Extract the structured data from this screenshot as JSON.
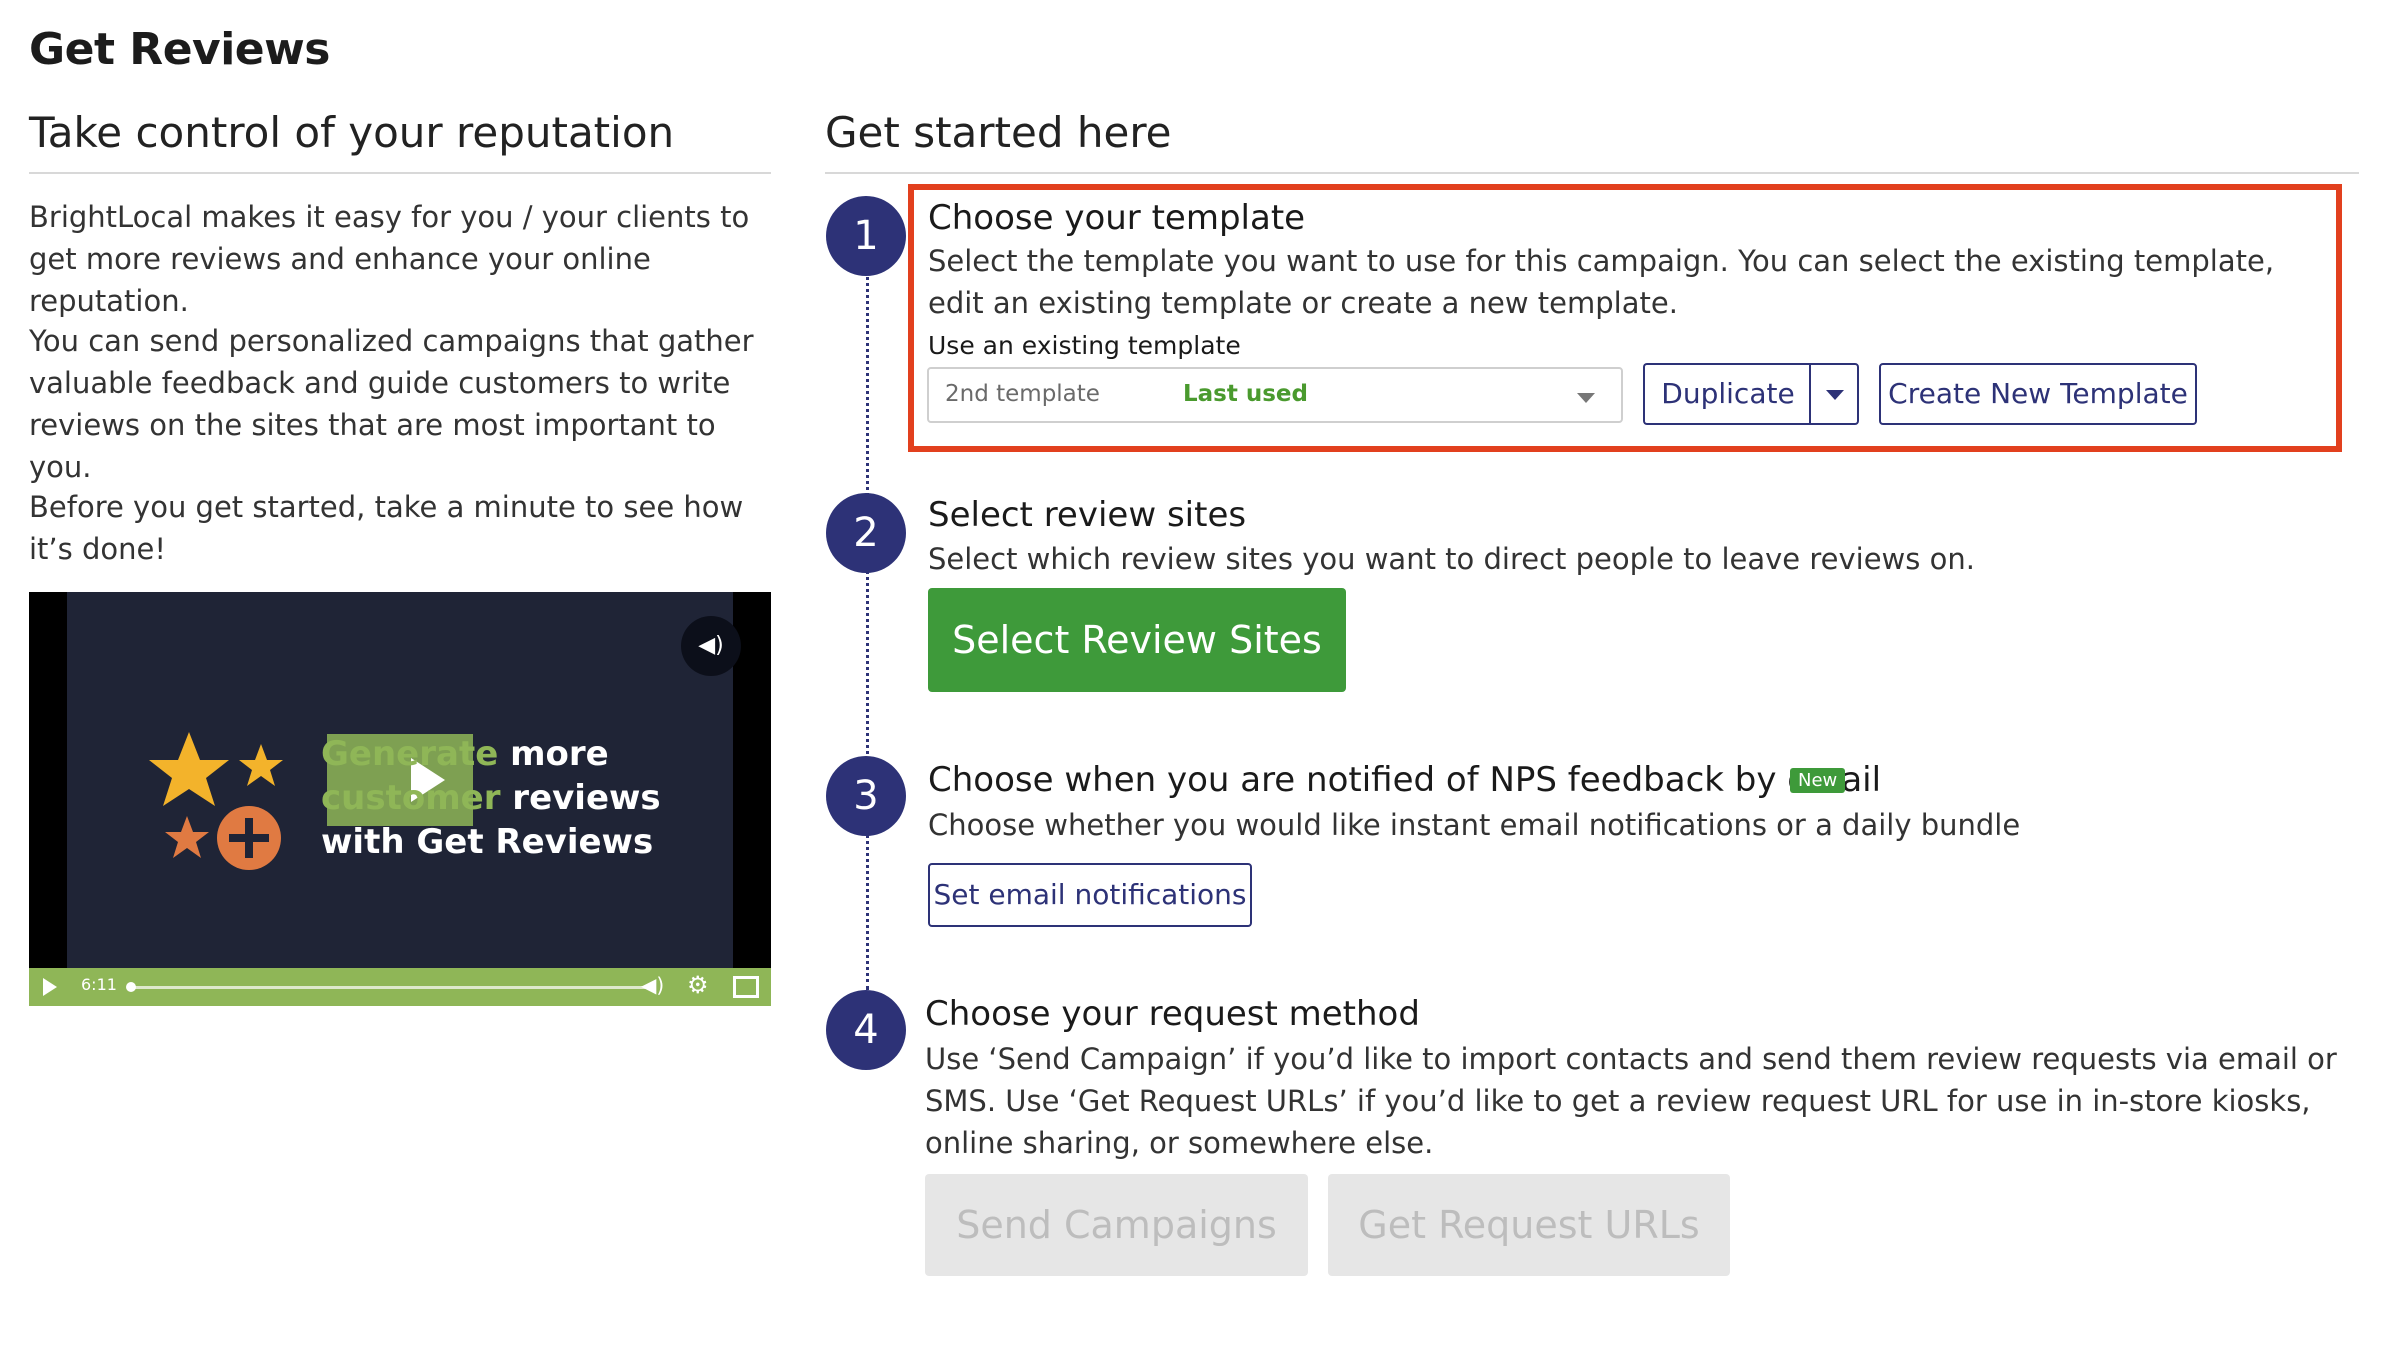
{
  "page": {
    "title": "Get Reviews"
  },
  "left": {
    "heading": "Take control of your reputation",
    "paragraphs": [
      "BrightLocal makes it easy for you / your clients to get more reviews and enhance your online reputation.",
      "You can send personalized campaigns that gather valuable feedback and guide customers to write reviews on the sites that are most important to you.",
      "Before you get started, take a minute to see how it’s done!"
    ],
    "video": {
      "line1_hl": "Generate",
      "line1": " more",
      "line2_hl": "customer",
      "line2": " reviews",
      "line3": "with Get Reviews",
      "time": "6:11",
      "progress": 0.0
    }
  },
  "right": {
    "heading": "Get started here",
    "steps": [
      {
        "number": "1",
        "title": "Choose your template",
        "description": "Select the template you want to use for this campaign. You can select the existing template, edit an existing template or create a new template.",
        "sub_label": "Use an existing template",
        "select_value": "2nd template",
        "select_badge": "Last used",
        "duplicate_label": "Duplicate",
        "create_label": "Create New Template"
      },
      {
        "number": "2",
        "title": "Select review sites",
        "description": "Select which review sites you want to direct people to leave reviews on.",
        "button_label": "Select Review Sites"
      },
      {
        "number": "3",
        "title": "Choose when you are notified of NPS feedback by email",
        "badge": "New",
        "description": "Choose whether you would like instant email notifications or a daily bundle",
        "button_label": "Set email notifications"
      },
      {
        "number": "4",
        "title": "Choose your request method",
        "description": "Use ‘Send Campaign’ if you’d like to import contacts and send them review requests via email or SMS. Use ‘Get Request URLs’ if you’d like to get a review request URL for use in in-store kiosks, online sharing, or somewhere else.",
        "send_label": "Send Campaigns",
        "urls_label": "Get Request URLs"
      }
    ]
  },
  "colors": {
    "primary": "#2d3277",
    "success": "#3e9a3a",
    "highlight": "#e2401e",
    "video_accent": "#8fb657"
  }
}
